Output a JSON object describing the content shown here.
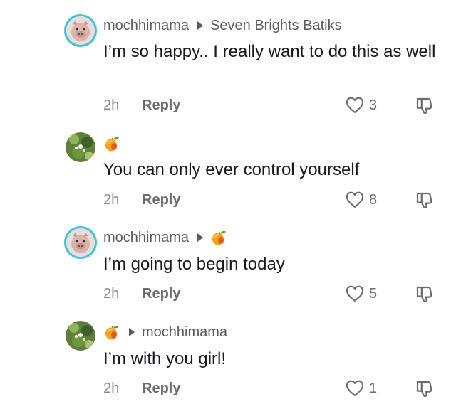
{
  "comments": [
    {
      "author": "mochhimama",
      "reply_to": "Seven Brights Batiks",
      "text": "I’m so happy.. I really want to do this as well",
      "time": "2h",
      "reply_label": "Reply",
      "likes": "3"
    },
    {
      "author": "",
      "author_icon": "mango-emoji",
      "text": "You can only ever control yourself",
      "time": "2h",
      "reply_label": "Reply",
      "likes": "8"
    },
    {
      "author": "mochhimama",
      "reply_to_icon": "mango-emoji",
      "text": "I’m going to begin today",
      "time": "2h",
      "reply_label": "Reply",
      "likes": "5"
    },
    {
      "author_icon": "mango-emoji",
      "reply_to": "mochhimama",
      "text": "I’m with you girl!",
      "time": "2h",
      "reply_label": "Reply",
      "likes": "1"
    }
  ],
  "colors": {
    "avatar_ring": "#3dc3d6",
    "text": "#161823",
    "muted": "#8a8b91"
  }
}
